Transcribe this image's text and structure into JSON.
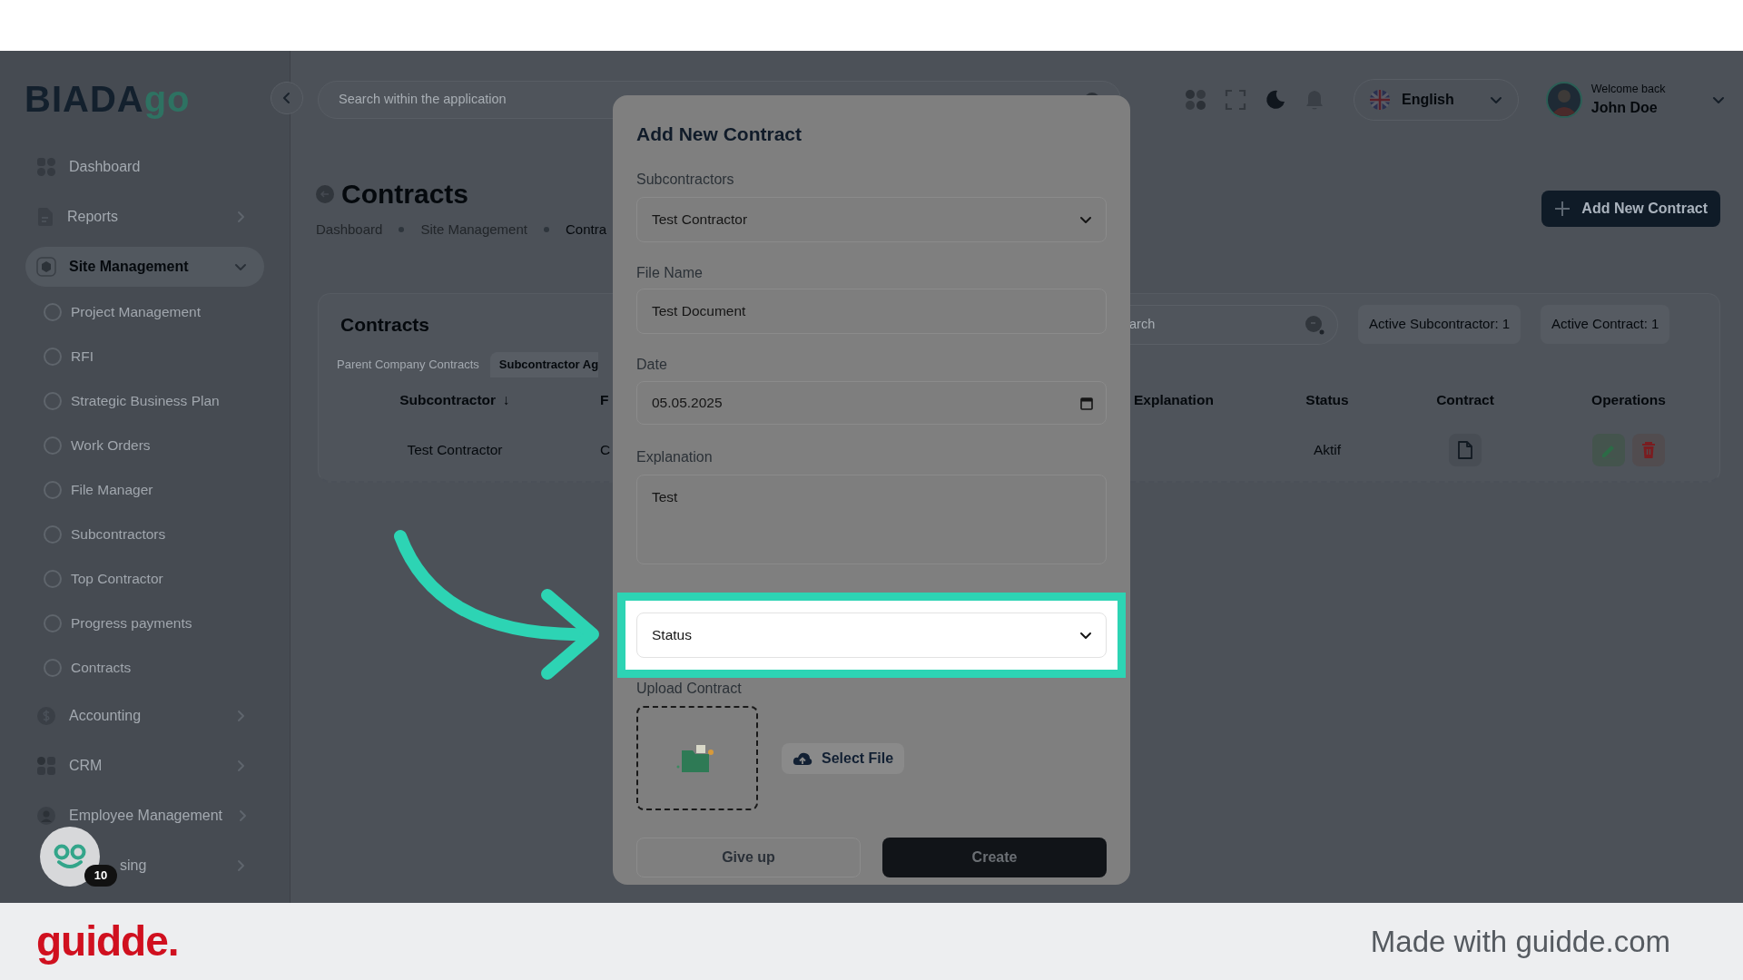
{
  "frame": {
    "brand": "guidde.",
    "credit": "Made with guidde.com"
  },
  "logo": {
    "text": "BIADA",
    "accent": "go"
  },
  "sidebar": {
    "items": [
      {
        "label": "Dashboard",
        "kind": "link",
        "selected": false
      },
      {
        "label": "Reports",
        "kind": "group",
        "expanded": false,
        "selected": false
      },
      {
        "label": "Site Management",
        "kind": "group",
        "expanded": true,
        "selected": true,
        "children": [
          {
            "label": "Project Management",
            "selected": false
          },
          {
            "label": "RFI",
            "selected": false
          },
          {
            "label": "Strategic Business Plan",
            "selected": false
          },
          {
            "label": "Work Orders",
            "selected": false
          },
          {
            "label": "File Manager",
            "selected": false
          },
          {
            "label": "Subcontractors",
            "selected": false
          },
          {
            "label": "Top Contractor",
            "selected": false
          },
          {
            "label": "Progress payments",
            "selected": false
          },
          {
            "label": "Contracts",
            "selected": false
          }
        ]
      },
      {
        "label": "Accounting",
        "kind": "group",
        "expanded": false,
        "selected": false
      },
      {
        "label": "CRM",
        "kind": "group",
        "expanded": false,
        "selected": false
      },
      {
        "label": "Employee Management",
        "kind": "group",
        "expanded": false,
        "selected": false
      },
      {
        "label": "sing",
        "kind": "group",
        "expanded": false,
        "selected": false
      }
    ]
  },
  "topbar": {
    "search": {
      "placeholder": "Search within the application"
    },
    "language": "English",
    "greeting": "Welcome back",
    "user": "John Doe"
  },
  "page": {
    "title": "Contracts",
    "breadcrumb": [
      "Dashboard",
      "Site Management",
      "Contra"
    ],
    "add_button": "Add New Contract"
  },
  "card": {
    "title": "Contracts",
    "search": {
      "placeholder": "arch"
    },
    "stats": [
      "Active Subcontractor: 1",
      "Active Contract: 1"
    ],
    "tabs": [
      {
        "label": "Parent Company Contracts",
        "selected": false
      },
      {
        "label": "Subcontractor Ag",
        "selected": true
      }
    ],
    "columns": [
      {
        "label": "Subcontractor",
        "sort": "↓"
      },
      {
        "label": "F"
      },
      {
        "label": "Explanation"
      },
      {
        "label": "Status"
      },
      {
        "label": "Contract"
      },
      {
        "label": "Operations"
      }
    ],
    "rows": [
      {
        "subcontractor": "Test Contractor",
        "column_2": "C",
        "status": "Aktif"
      }
    ]
  },
  "modal": {
    "title": "Add New Contract",
    "fields": [
      {
        "label": "Subcontractors",
        "kind": "select",
        "value": "Test Contractor",
        "highlighted": false
      },
      {
        "label": "File Name",
        "kind": "text",
        "value": "Test Document",
        "highlighted": false
      },
      {
        "label": "Date",
        "kind": "date",
        "value": "05.05.2025",
        "highlighted": false
      },
      {
        "label": "Explanation",
        "kind": "textarea",
        "value": "Test",
        "highlighted": false
      },
      {
        "kind": "select",
        "placeholder": "Status",
        "highlighted": true
      }
    ],
    "upload": {
      "label": "Upload Contract",
      "button": "Select File"
    },
    "buttons": [
      "Give up",
      "Create"
    ]
  },
  "widget": {
    "badge": "10"
  }
}
